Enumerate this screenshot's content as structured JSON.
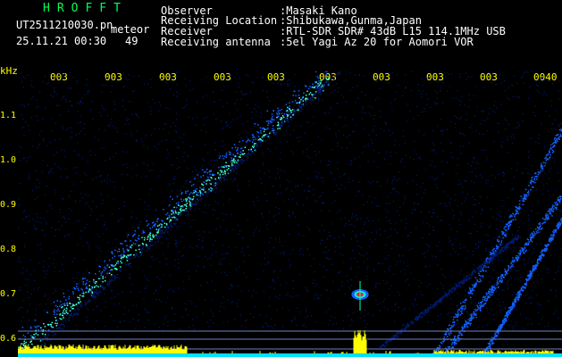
{
  "header": {
    "title": "HROFFT",
    "filename": "UT2511210030.pn",
    "mode": "meteor",
    "date_time": "25.11.21 00:30",
    "count": "49",
    "info_labels": [
      "Observer",
      "Receiving Location",
      "Receiver",
      "Receiving antenna"
    ],
    "info_values": [
      ":Masaki Kano",
      ":Shibukawa,Gunma,Japan",
      ":RTL-SDR SDR# 43dB L15 114.1MHz USB",
      ":5el Yagi Az 20 for Aomori VOR"
    ]
  },
  "spectrogram": {
    "y_unit": "kHz",
    "y_ticks": [
      "1.1",
      "1.0",
      "0.9",
      "0.8",
      "0.7",
      "0.6"
    ],
    "time_labels": [
      "003",
      "003",
      "003",
      "003",
      "003",
      "003",
      "003",
      "003",
      "003",
      "0040"
    ],
    "colors": {
      "background": "#000000",
      "low": "#001a6e",
      "mid": "#1060ff",
      "high": "#40ffd0",
      "signal": "#ffff00",
      "baseline": "#00e0ff"
    }
  }
}
